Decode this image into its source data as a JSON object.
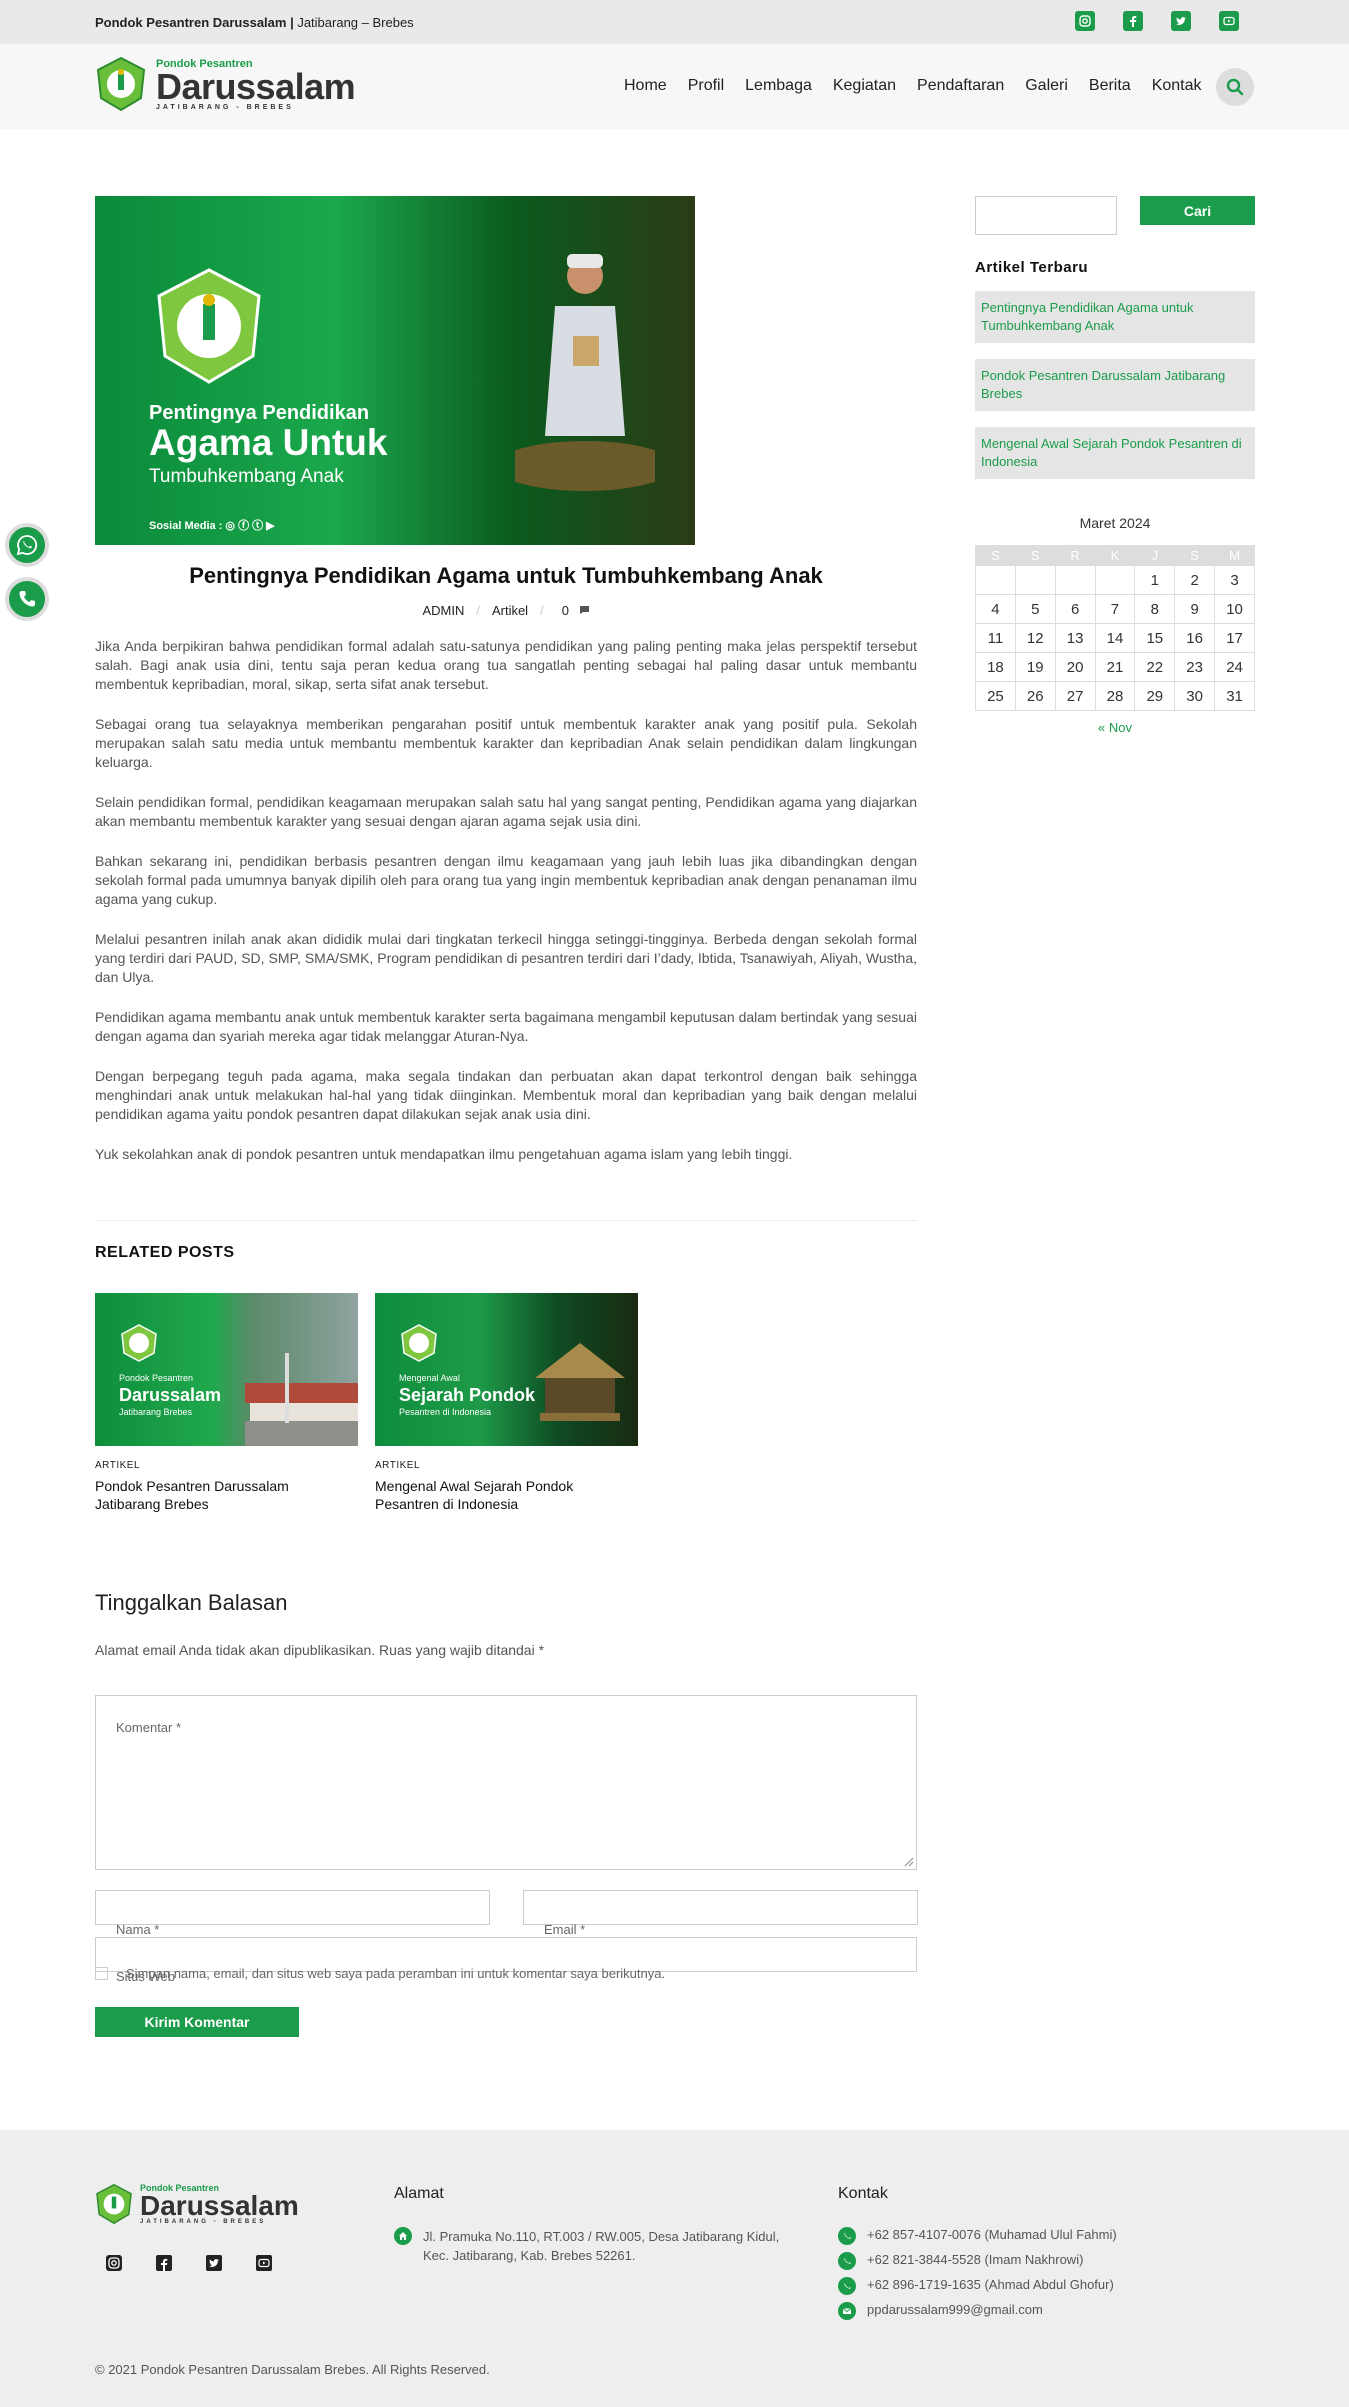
{
  "topbar": {
    "site_name": "Pondok Pesantren Darussalam |",
    "location": " Jatibarang – Brebes"
  },
  "logo": {
    "small": "Pondok Pesantren",
    "big": "Darussalam",
    "sub": "JATIBARANG - BREBES"
  },
  "nav": {
    "items": [
      "Home",
      "Profil",
      "Lembaga",
      "Kegiatan",
      "Pendaftaran",
      "Galeri",
      "Berita",
      "Kontak"
    ]
  },
  "hero": {
    "line1": "Pentingnya Pendidikan",
    "line2": "Agama Untuk",
    "line3": "Tumbuhkembang Anak",
    "social": "Sosial Media :"
  },
  "post": {
    "title": "Pentingnya Pendidikan Agama untuk Tumbuhkembang Anak",
    "author": "ADMIN",
    "category": "Artikel",
    "comments": "0",
    "paragraphs": [
      "Jika Anda berpikiran bahwa pendidikan formal adalah satu-satunya pendidikan yang paling penting maka jelas perspektif tersebut salah. Bagi anak usia dini, tentu saja peran kedua orang tua sangatlah penting sebagai hal paling dasar untuk membantu membentuk kepribadian, moral, sikap, serta sifat anak tersebut.",
      "Sebagai orang tua selayaknya memberikan pengarahan positif untuk membentuk karakter anak yang positif pula. Sekolah merupakan salah satu media untuk membantu membentuk karakter dan kepribadian Anak selain pendidikan dalam lingkungan keluarga.",
      "Selain pendidikan formal, pendidikan keagamaan merupakan salah satu hal yang sangat penting, Pendidikan agama yang diajarkan akan membantu membentuk karakter yang sesuai dengan ajaran agama sejak usia dini.",
      "Bahkan sekarang ini, pendidikan berbasis pesantren dengan ilmu keagamaan yang jauh lebih luas jika dibandingkan dengan sekolah formal pada umumnya banyak dipilih oleh para orang tua yang ingin membentuk kepribadian anak dengan penanaman ilmu agama yang cukup.",
      "Melalui pesantren inilah anak akan dididik mulai dari tingkatan terkecil hingga setinggi-tingginya. Berbeda dengan sekolah formal yang terdiri dari PAUD, SD, SMP, SMA/SMK, Program pendidikan di pesantren terdiri dari I’dady, Ibtida, Tsanawiyah, Aliyah, Wustha, dan Ulya.",
      "Pendidikan agama membantu anak untuk membentuk karakter serta bagaimana mengambil keputusan dalam bertindak yang sesuai dengan agama dan syariah mereka agar tidak melanggar Aturan-Nya.",
      "Dengan berpegang teguh pada agama, maka segala tindakan dan perbuatan akan dapat terkontrol dengan baik sehingga menghindari anak untuk melakukan hal-hal yang tidak diinginkan. Membentuk moral dan kepribadian yang baik dengan melalui pendidikan agama yaitu pondok pesantren dapat dilakukan sejak anak usia dini.",
      "Yuk sekolahkan anak di pondok pesantren untuk mendapatkan ilmu pengetahuan agama islam yang lebih tinggi."
    ]
  },
  "related": {
    "heading": "RELATED POSTS",
    "posts": [
      {
        "category": "ARTIKEL",
        "title": "Pondok Pesantren Darussalam Jatibarang Brebes",
        "img_l1": "Pondok Pesantren",
        "img_l2": "Darussalam",
        "img_l3": "Jatibarang Brebes"
      },
      {
        "category": "ARTIKEL",
        "title": "Mengenal Awal Sejarah Pondok Pesantren di Indonesia",
        "img_l1": "Mengenal Awal",
        "img_l2": "Sejarah Pondok",
        "img_l3": "Pesantren di Indonesia"
      }
    ]
  },
  "comment_form": {
    "heading": "Tinggalkan Balasan",
    "note": "Alamat email Anda tidak akan dipublikasikan. Ruas yang wajib ditandai *",
    "comment_label": "Komentar *",
    "name_label": "Nama *",
    "email_label": "Email *",
    "website_label": "Situs Web",
    "save_label": "Simpan nama, email, dan situs web saya pada peramban ini untuk komentar saya berikutnya.",
    "submit": "Kirim Komentar"
  },
  "sidebar": {
    "search_button": "Cari",
    "recent_heading": "Artikel Terbaru",
    "recent": [
      "Pentingnya Pendidikan Agama untuk Tumbuhkembang Anak",
      "Pondok Pesantren Darussalam Jatibarang Brebes",
      "Mengenal Awal Sejarah Pondok Pesantren di Indonesia"
    ],
    "calendar": {
      "caption": "Maret 2024",
      "days": [
        "S",
        "S",
        "R",
        "K",
        "J",
        "S",
        "M"
      ],
      "weeks": [
        [
          "",
          "",
          "",
          "",
          "1",
          "2",
          "3"
        ],
        [
          "4",
          "5",
          "6",
          "7",
          "8",
          "9",
          "10"
        ],
        [
          "11",
          "12",
          "13",
          "14",
          "15",
          "16",
          "17"
        ],
        [
          "18",
          "19",
          "20",
          "21",
          "22",
          "23",
          "24"
        ],
        [
          "25",
          "26",
          "27",
          "28",
          "29",
          "30",
          "31"
        ]
      ],
      "prev": "« Nov"
    }
  },
  "footer": {
    "address_heading": "Alamat",
    "address": "Jl. Pramuka No.110, RT.003 / RW.005, Desa Jatibarang Kidul, Kec. Jatibarang, Kab. Brebes 52261.",
    "contact_heading": "Kontak",
    "contacts": [
      "+62 857-4107-0076 (Muhamad Ulul Fahmi)",
      "+62 821-3844-5528 (Imam Nakhrowi)",
      "+62 896-1719-1635 (Ahmad Abdul Ghofur)",
      "ppdarussalam999@gmail.com"
    ],
    "copyright": "© 2021 Pondok Pesantren Darussalam Brebes. All Rights Reserved."
  },
  "colors": {
    "accent": "#1a9c4a",
    "topbar": "#e9e9e9",
    "footer": "#eeeeee"
  },
  "icons": [
    "instagram-icon",
    "facebook-icon",
    "twitter-icon",
    "youtube-icon",
    "search-icon",
    "whatsapp-icon",
    "phone-icon",
    "home-icon",
    "mail-icon",
    "comment-icon"
  ]
}
